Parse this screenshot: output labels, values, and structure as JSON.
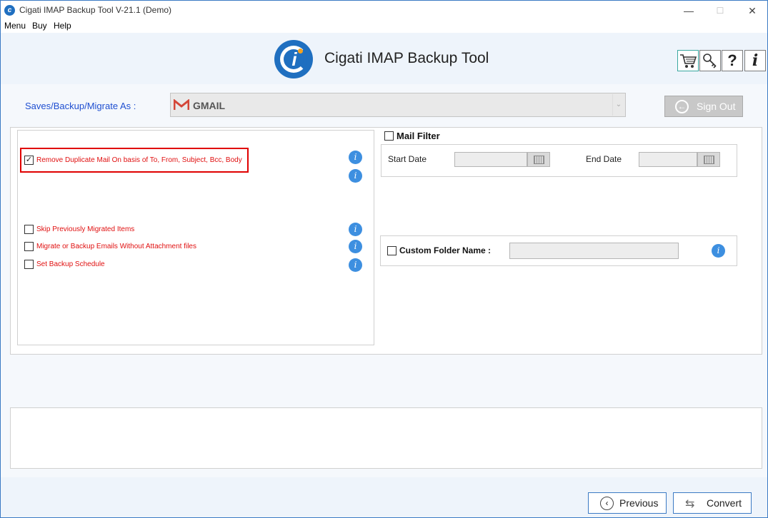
{
  "window": {
    "title": "Cigati IMAP Backup Tool V-21.1 (Demo)",
    "minimize": "—",
    "maximize": "☐",
    "close": "✕"
  },
  "menu": [
    "Menu",
    "Buy",
    "Help"
  ],
  "header": {
    "app_title": "Cigati IMAP Backup Tool",
    "buttons": [
      {
        "name": "cart-icon"
      },
      {
        "name": "key-icon"
      },
      {
        "name": "help-icon",
        "glyph": "?"
      },
      {
        "name": "info-icon",
        "glyph": "i"
      }
    ]
  },
  "saves": {
    "label": "Saves/Backup/Migrate As :",
    "selected": "GMAIL",
    "sign_out": "Sign Out"
  },
  "options": [
    {
      "label": "Remove Duplicate Mail On basis of To, From, Subject, Bcc, Body",
      "checked": true
    },
    {
      "label": "Skip Previously Migrated Items",
      "checked": false
    },
    {
      "label": "Migrate or Backup Emails Without Attachment files",
      "checked": false
    },
    {
      "label": "Set Backup Schedule",
      "checked": false
    }
  ],
  "mail_filter": {
    "label": "Mail Filter",
    "start_date_label": "Start Date",
    "end_date_label": "End Date"
  },
  "custom_folder": {
    "label": "Custom Folder Name :"
  },
  "footer": {
    "previous": "Previous",
    "convert": "Convert"
  },
  "colors": {
    "accent": "#1f6fc0",
    "option_text": "#e01010",
    "highlight": "#e00000",
    "info_icon": "#3d8fe0"
  }
}
